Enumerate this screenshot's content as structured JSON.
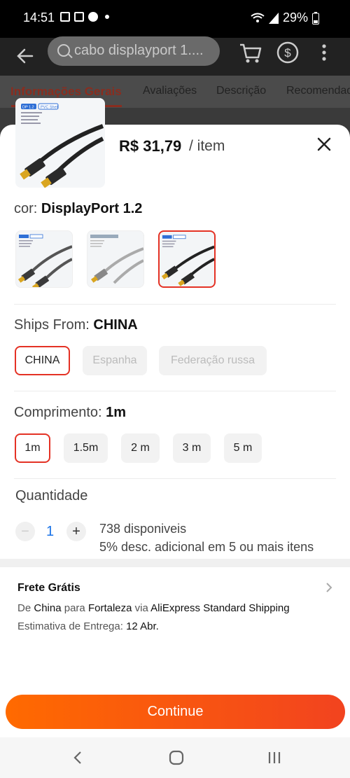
{
  "status_bar": {
    "time": "14:51",
    "battery": "29%"
  },
  "search": {
    "value": "cabo displayport 1...."
  },
  "tabs": [
    {
      "label": "Informações Gerais"
    },
    {
      "label": "Avaliações"
    },
    {
      "label": "Descrição"
    },
    {
      "label": "Recomendad"
    }
  ],
  "sheet": {
    "price": "R$ 31,79",
    "per_unit": "/ item",
    "color_label": "cor:",
    "color_value": "DisplayPort 1.2",
    "ships_label": "Ships From:",
    "ships_value": "CHINA",
    "ships_options": [
      "CHINA",
      "Espanha",
      "Federação russa"
    ],
    "length_label": "Comprimento:",
    "length_value": "1m",
    "length_options": [
      "1m",
      "1.5m",
      "2 m",
      "3 m",
      "5 m"
    ],
    "quantity_label": "Quantidade",
    "quantity_value": "1",
    "qty_minus": "−",
    "qty_plus": "+",
    "stock_text": "738 disponiveis",
    "discount_text": "5% desc. adicional em 5 ou mais itens",
    "thumb_badges": [
      "DP 1.2",
      "PVC Shell"
    ]
  },
  "shipping": {
    "title": "Frete Grátis",
    "from_prefix": "De",
    "from": "China",
    "to_prefix": "para",
    "to": "Fortaleza",
    "via_prefix": "via",
    "via": "AliExpress Standard Shipping",
    "eta_label": "Estimativa de Entrega:",
    "eta": "12 Abr."
  },
  "cta": {
    "label": "Continue"
  },
  "colors": {
    "accent": "#e43225",
    "cta_start": "#ff6a00",
    "cta_end": "#f2431f",
    "link": "#1a73e8"
  }
}
